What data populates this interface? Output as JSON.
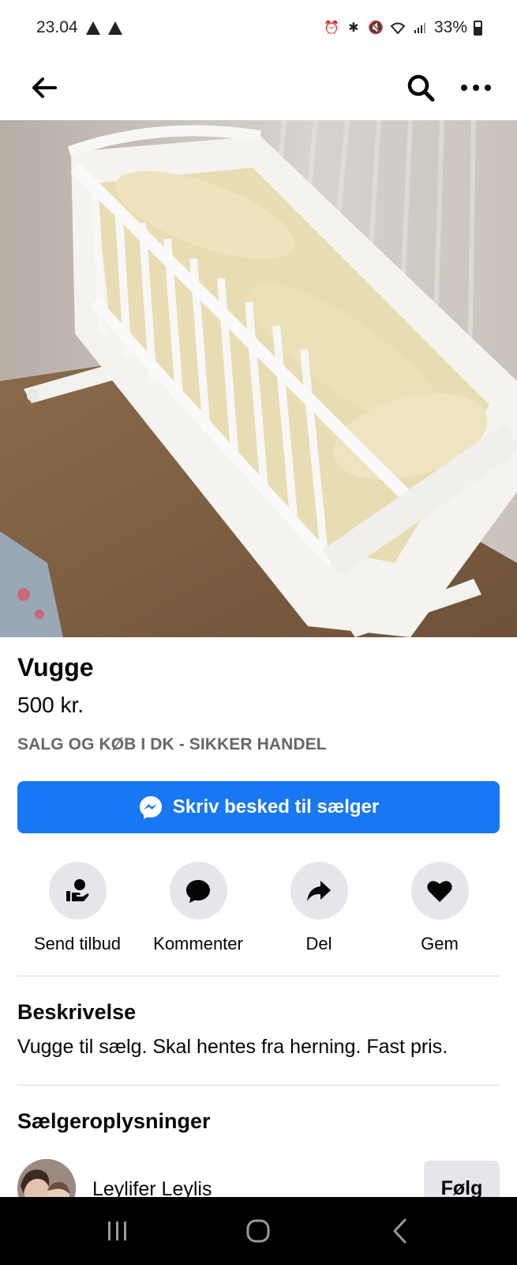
{
  "status_bar": {
    "time": "23.04",
    "battery": "33%",
    "icons": [
      "alarm-icon",
      "bluetooth-icon",
      "mute-icon",
      "wifi-icon",
      "signal-icon",
      "battery-icon"
    ]
  },
  "header": {
    "back_icon": "arrow-left-icon",
    "search_icon": "search-icon",
    "more_icon": "more-dots-icon"
  },
  "photo": {
    "image_count": 5,
    "active_index": 1
  },
  "listing": {
    "title": "Vugge",
    "price": "500 kr.",
    "group": "SALG OG KØB I DK - SIKKER HANDEL",
    "message_button": "Skriv besked til sælger"
  },
  "actions": [
    {
      "label": "Send tilbud",
      "icon": "offer-hand-icon"
    },
    {
      "label": "Kommenter",
      "icon": "comment-icon"
    },
    {
      "label": "Del",
      "icon": "share-icon"
    },
    {
      "label": "Gem",
      "icon": "heart-icon"
    }
  ],
  "description": {
    "heading": "Beskrivelse",
    "text": "Vugge til sælg. Skal hentes fra herning. Fast pris."
  },
  "seller": {
    "heading": "Sælgeroplysninger",
    "name": "Leylifer Leylis",
    "follow_label": "Følg"
  },
  "colors": {
    "primary": "#1877f2",
    "secondary_bg": "#e4e6eb",
    "muted_text": "#65676b"
  }
}
